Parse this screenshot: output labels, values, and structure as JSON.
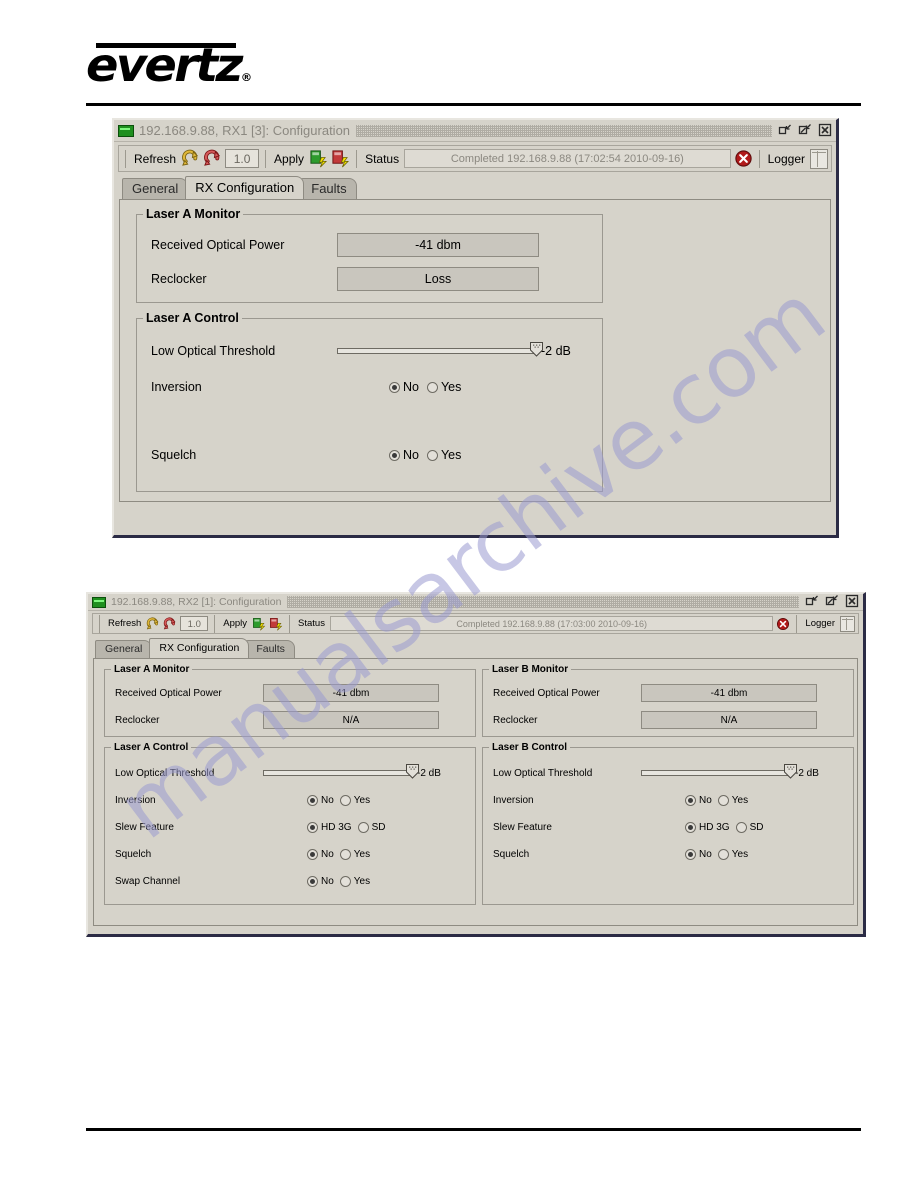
{
  "page": {
    "brand": "evertz",
    "brand_registered": "®"
  },
  "windows": [
    {
      "id": "win1",
      "titlebar": {
        "title": "192.168.9.88, RX1  [3]: Configuration",
        "app_icon": "card-icon",
        "restore_label": "Restore",
        "maximize_label": "Maximize",
        "close_label": "Close"
      },
      "toolbar": {
        "refresh_label": "Refresh",
        "refresh_icon": "refresh-yellow-icon",
        "refresh_all_icon": "refresh-red-icon",
        "version_value": "1.0",
        "apply_label": "Apply",
        "apply_icon": "apply-green-icon",
        "apply_all_icon": "apply-red-icon",
        "status_label": "Status",
        "status_value": "Completed 192.168.9.88 (17:02:54  2010-09-16)",
        "stop_icon": "stop-error-icon",
        "logger_label": "Logger",
        "logger_icon": "logger-grid-icon"
      },
      "tabs": [
        {
          "label": "General",
          "active": false
        },
        {
          "label": "RX Configuration",
          "active": true
        },
        {
          "label": "Faults",
          "active": false
        }
      ],
      "groups": [
        {
          "legend": "Laser A Monitor",
          "rows": [
            {
              "label": "Received Optical Power",
              "type": "value",
              "value": "-41 dbm"
            },
            {
              "label": "Reclocker",
              "type": "value",
              "value": "Loss"
            }
          ]
        },
        {
          "legend": "Laser A Control",
          "rows": [
            {
              "label": "Low Optical Threshold",
              "type": "slider",
              "value": "-2 dB",
              "percent": 100
            },
            {
              "label": "Inversion",
              "type": "radio",
              "options": [
                "No",
                "Yes"
              ],
              "selected": "No"
            },
            {
              "label": "Squelch",
              "type": "radio",
              "options": [
                "No",
                "Yes"
              ],
              "selected": "No"
            }
          ]
        }
      ]
    },
    {
      "id": "win2",
      "titlebar": {
        "title": "192.168.9.88, RX2  [1]: Configuration",
        "app_icon": "card-icon",
        "restore_label": "Restore",
        "maximize_label": "Maximize",
        "close_label": "Close"
      },
      "toolbar": {
        "refresh_label": "Refresh",
        "refresh_icon": "refresh-yellow-icon",
        "refresh_all_icon": "refresh-red-icon",
        "version_value": "1.0",
        "apply_label": "Apply",
        "apply_icon": "apply-green-icon",
        "apply_all_icon": "apply-red-icon",
        "status_label": "Status",
        "status_value": "Completed 192.168.9.88 (17:03:00  2010-09-16)",
        "stop_icon": "stop-error-icon",
        "logger_label": "Logger",
        "logger_icon": "logger-grid-icon"
      },
      "tabs": [
        {
          "label": "General",
          "active": false
        },
        {
          "label": "RX Configuration",
          "active": true
        },
        {
          "label": "Faults",
          "active": false
        }
      ],
      "groups": [
        {
          "legend": "Laser A Monitor",
          "rows": [
            {
              "label": "Received Optical Power",
              "type": "value",
              "value": "-41 dbm"
            },
            {
              "label": "Reclocker",
              "type": "value",
              "value": "N/A"
            }
          ]
        },
        {
          "legend": "Laser B Monitor",
          "rows": [
            {
              "label": "Received Optical Power",
              "type": "value",
              "value": "-41 dbm"
            },
            {
              "label": "Reclocker",
              "type": "value",
              "value": "N/A"
            }
          ]
        },
        {
          "legend": "Laser A Control",
          "rows": [
            {
              "label": "Low Optical Threshold",
              "type": "slider",
              "value": "-2 dB",
              "percent": 100
            },
            {
              "label": "Inversion",
              "type": "radio",
              "options": [
                "No",
                "Yes"
              ],
              "selected": "No"
            },
            {
              "label": "Slew Feature",
              "type": "radio",
              "options": [
                "HD 3G",
                "SD"
              ],
              "selected": "HD 3G"
            },
            {
              "label": "Squelch",
              "type": "radio",
              "options": [
                "No",
                "Yes"
              ],
              "selected": "No"
            },
            {
              "label": "Swap Channel",
              "type": "radio",
              "options": [
                "No",
                "Yes"
              ],
              "selected": "No"
            }
          ]
        },
        {
          "legend": "Laser B Control",
          "rows": [
            {
              "label": "Low Optical Threshold",
              "type": "slider",
              "value": "-2 dB",
              "percent": 100
            },
            {
              "label": "Inversion",
              "type": "radio",
              "options": [
                "No",
                "Yes"
              ],
              "selected": "No"
            },
            {
              "label": "Slew Feature",
              "type": "radio",
              "options": [
                "HD 3G",
                "SD"
              ],
              "selected": "HD 3G"
            },
            {
              "label": "Squelch",
              "type": "radio",
              "options": [
                "No",
                "Yes"
              ],
              "selected": "No"
            }
          ]
        }
      ]
    }
  ],
  "watermark": {
    "text": "manualsarchive.com",
    "color": "#9b9bd0"
  },
  "colors": {
    "window_face": "#d6d3ca",
    "field_face": "#c9c6be",
    "tab_inactive": "#b8b5ac",
    "disabled_text": "#8b8880",
    "accent_green": "#1f8f1f",
    "accent_red": "#b11a1a",
    "accent_yellow": "#e0b83a"
  }
}
